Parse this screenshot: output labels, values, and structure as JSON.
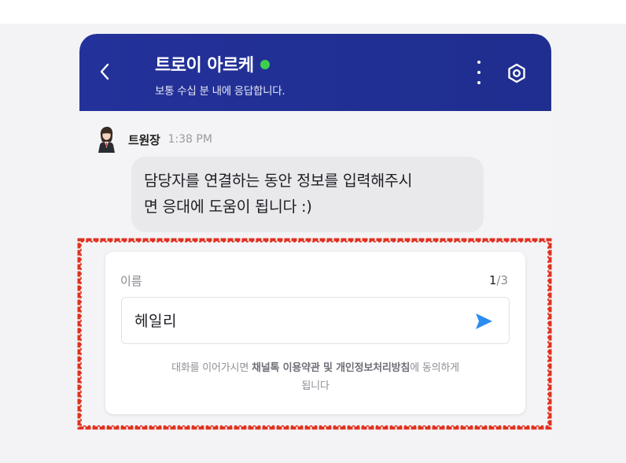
{
  "header": {
    "title": "트로이 아르케",
    "subtitle": "보통 수십 분 내에 응답합니다.",
    "online_color": "#3ccf4e",
    "back_icon": "chevron-left-icon",
    "more_icon": "more-vertical-icon",
    "settings_icon": "settings-icon"
  },
  "message": {
    "sender": "트원장",
    "time": "1:38 PM",
    "line1": "담당자를 연결하는 동안 정보를 입력해주시",
    "line2": "면 응대에 도움이 됩니다 :)"
  },
  "form": {
    "field_label": "이름",
    "step_current": "1",
    "step_total": "/3",
    "input_value": "헤일리",
    "send_icon": "send-icon",
    "consent_prefix": "대화를 이어가시면 ",
    "consent_terms": "채널톡 이용약관",
    "consent_and": " 및 ",
    "consent_privacy": "개인정보처리방침",
    "consent_suffix": "에 동의하게",
    "consent_line2": "됩니다"
  },
  "colors": {
    "header_bg": "#23319a",
    "highlight": "#e0301e",
    "send": "#2d8cf0"
  }
}
